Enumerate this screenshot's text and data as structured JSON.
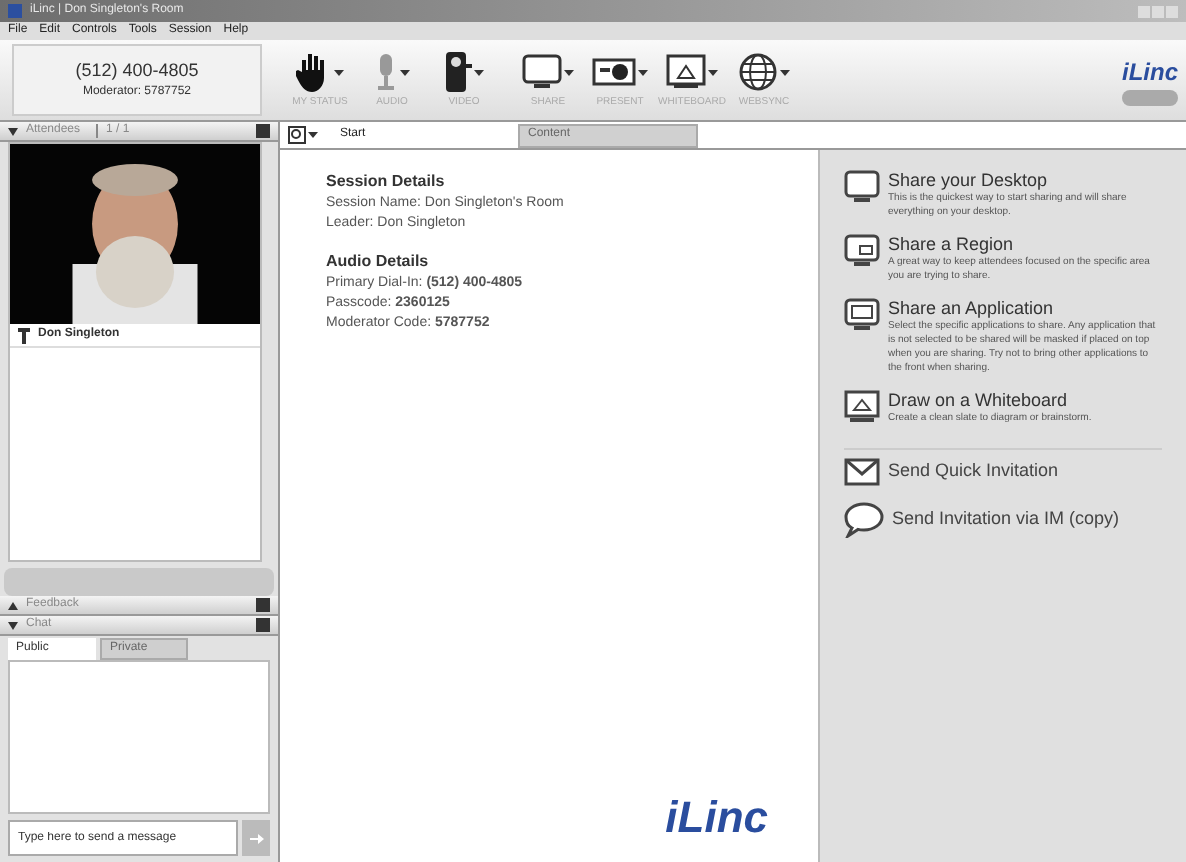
{
  "window": {
    "title": "iLinc | Don Singleton's Room"
  },
  "menu": [
    "File",
    "Edit",
    "Controls",
    "Tools",
    "Session",
    "Help"
  ],
  "phone": {
    "number": "(512) 400-4805",
    "moderator": "Moderator: 5787752"
  },
  "toolbar": [
    {
      "label": "MY STATUS",
      "kind": "hand"
    },
    {
      "label": "AUDIO",
      "kind": "mic"
    },
    {
      "label": "VIDEO",
      "kind": "camera"
    },
    {
      "label": "SHARE",
      "kind": "monitor"
    },
    {
      "label": "PRESENT",
      "kind": "projector"
    },
    {
      "label": "WHITEBOARD",
      "kind": "board"
    },
    {
      "label": "WEBSYNC",
      "kind": "globe"
    }
  ],
  "logo": "iLinc",
  "attendees": {
    "title": "Attendees",
    "count": "1 / 1",
    "items": [
      {
        "name": "Don Singleton"
      }
    ]
  },
  "feedback": {
    "title": "Feedback"
  },
  "chat": {
    "title": "Chat",
    "tabs": [
      {
        "label": "Public",
        "selected": true
      },
      {
        "label": "Private",
        "selected": false
      }
    ],
    "placeholder": "Type here to send a message"
  },
  "tabs": [
    {
      "label": "Start",
      "selected": true
    },
    {
      "label": "Content",
      "selected": false
    }
  ],
  "session": {
    "heading": "Session Details",
    "lines": [
      "Session Name: Don Singleton's Room",
      "Leader: Don Singleton"
    ]
  },
  "audio": {
    "heading": "Audio Details",
    "lines": [
      "Primary Dial-In: **(512) 400-4805**",
      "Passcode: **2360125**",
      "Moderator Code: **5787752**"
    ]
  },
  "footer_logo": "iLinc",
  "actions": [
    {
      "kind": "desktop",
      "title": "Share your Desktop",
      "text": "This is the quickest way to start sharing and will share everything on your desktop."
    },
    {
      "kind": "region",
      "title": "Share a Region",
      "text": "A great way to keep attendees focused on the specific area you are trying to share."
    },
    {
      "kind": "application",
      "title": "Share an Application",
      "text": "Select the specific applications to share. Any application that is not selected to be shared will be masked if placed on top when you are sharing. Try not to bring other applications to the front when sharing."
    },
    {
      "kind": "whiteboard",
      "title": "Draw on a Whiteboard",
      "text": "Create a clean slate to diagram or brainstorm."
    }
  ],
  "invites": [
    {
      "kind": "mail",
      "label": "Send Quick Invitation"
    },
    {
      "kind": "chat",
      "label": "Send Invitation via IM (copy)"
    }
  ]
}
